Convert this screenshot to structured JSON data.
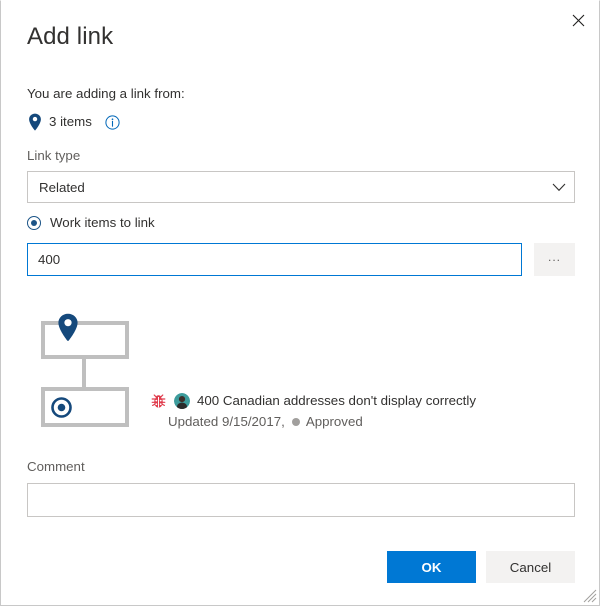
{
  "dialog": {
    "title": "Add link",
    "close_label": "Close",
    "close_icon": "close-icon",
    "resize_grip": "resize-grip"
  },
  "source": {
    "lead_text": "You are adding a link from:",
    "pin_icon": "location-pin-icon",
    "items_count": "3 items",
    "info_icon": "info-circle-icon"
  },
  "link_type": {
    "label": "Link type",
    "value": "Related",
    "chevron_icon": "chevron-down-icon",
    "options": [
      "Related"
    ]
  },
  "work_items": {
    "radio_label": "Work items to link",
    "radio_selected": true,
    "input_value": "400",
    "input_placeholder": "",
    "browse_label": "...",
    "browse_icon": "ellipsis-icon"
  },
  "tree": {
    "parent_icon": "location-pin-icon",
    "child_icon": "target-circle-icon",
    "box_color": "#bfbfbf",
    "icon_color": "#1b5487"
  },
  "result": {
    "type_icon": "bug-icon",
    "type_icon_color": "#e03b4c",
    "avatar_icon": "user-avatar",
    "title": "400 Canadian addresses don't display correctly",
    "updated": "Updated 9/15/2017,",
    "state_dot_color": "#a19f9d",
    "state": "Approved"
  },
  "comment": {
    "label": "Comment",
    "value": "",
    "placeholder": ""
  },
  "footer": {
    "ok_label": "OK",
    "cancel_label": "Cancel",
    "accent_color": "#0078d4"
  }
}
